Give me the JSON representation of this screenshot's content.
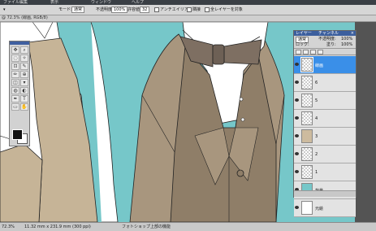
{
  "topbar": {
    "menu1": "ファイル編集",
    "menu2": "表示",
    "menu3": "ウィンドウ",
    "menu4": "ヘルプ"
  },
  "options": {
    "mode_label": "モード:",
    "mode_value": "通常",
    "opacity_label": "不透明度:",
    "opacity_value": "100%",
    "tolerance_label": "許容値:",
    "tolerance_value": "32",
    "antialias": "アンチエイリアス",
    "contiguous": "隣接",
    "all_layers": "全レイヤーを対象"
  },
  "docinfo": {
    "text": "@ 72.3% (線画, RGB/8)"
  },
  "tools": {
    "icons": [
      "move-icon",
      "zoom-icon",
      "lasso-icon",
      "wand-icon",
      "crop-icon",
      "eyedropper-icon",
      "brush-icon",
      "stamp-icon",
      "eraser-icon",
      "bucket-icon",
      "blur-icon",
      "dodge-icon",
      "pen-icon",
      "type-icon",
      "shape-icon",
      "hand-icon"
    ],
    "glyphs": [
      "✥",
      "⌕",
      "◌",
      "✧",
      "⊡",
      "✎",
      "✏",
      "⊕",
      "◫",
      "▾",
      "◍",
      "◐",
      "✒",
      "T",
      "▭",
      "✋"
    ]
  },
  "layers": {
    "tab1": "レイヤー",
    "tab2": "チャンネル",
    "blend": "通常",
    "opacity_label": "不透明度:",
    "opacity_value": "100%",
    "lock_label": "ロック:",
    "fill_label": "塗り:",
    "fill_value": "100%",
    "items": [
      {
        "name": "線画",
        "active": true,
        "thumb": "sel"
      },
      {
        "name": "6",
        "active": false,
        "thumb": "checker"
      },
      {
        "name": "5",
        "active": false,
        "thumb": "checker"
      },
      {
        "name": "4",
        "active": false,
        "thumb": "checker"
      },
      {
        "name": "3",
        "active": false,
        "thumb": "fig"
      },
      {
        "name": "2",
        "active": false,
        "thumb": "checker"
      },
      {
        "name": "1",
        "active": false,
        "thumb": "checker"
      },
      {
        "name": "背景",
        "active": false,
        "thumb": "teal"
      },
      {
        "name": "元絵",
        "active": false,
        "thumb": "white"
      }
    ]
  },
  "status": {
    "zoom": "72.3%",
    "size": "11.32 mm x 231.9 mm (300 ppi)",
    "info": "フォトショップ上部の機能"
  },
  "colors": {
    "background": "#76c7c9",
    "selected_layer": "#3a8fe8",
    "vest": "#a8967e",
    "shirt": "#ffffff",
    "tie": "#7e6f62"
  }
}
